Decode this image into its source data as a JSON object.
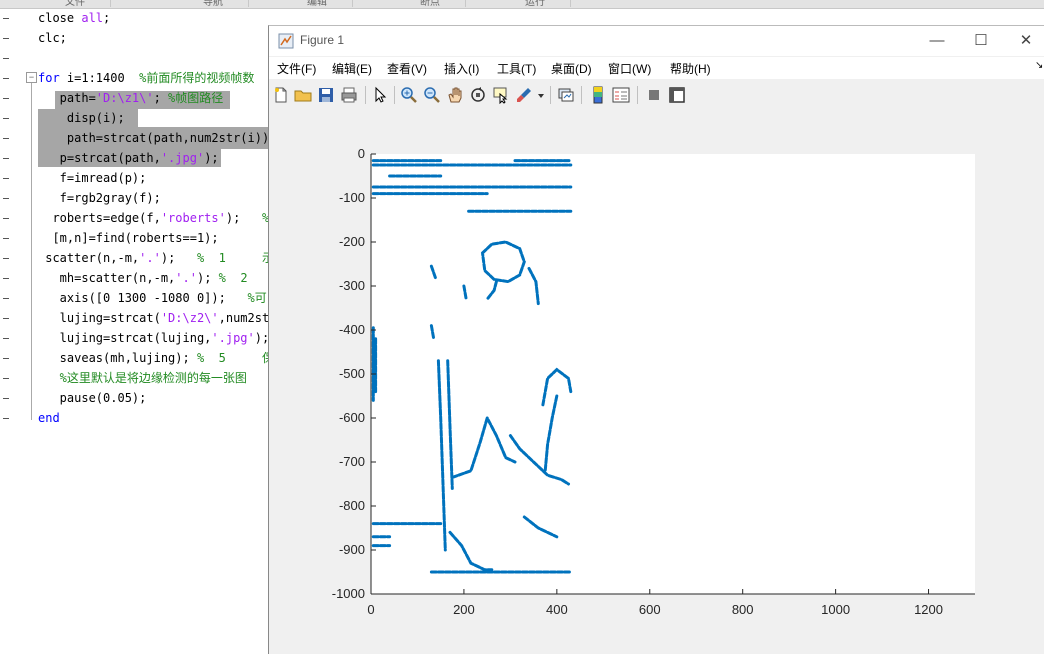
{
  "editor": {
    "top_tabs": [
      "文件",
      "导航",
      "编辑",
      "断点",
      "运行"
    ],
    "lines": [
      {
        "segments": [
          {
            "t": "close ",
            "c": "n"
          },
          {
            "t": "all",
            "c": "str"
          },
          {
            "t": ";",
            "c": "n"
          }
        ]
      },
      {
        "segments": [
          {
            "t": "clc;",
            "c": "n"
          }
        ]
      },
      {
        "segments": []
      },
      {
        "segments": [
          {
            "t": "for",
            "c": "kw"
          },
          {
            "t": " i=1:1400  ",
            "c": "n"
          },
          {
            "t": "%前面所得的视频帧数",
            "c": "com"
          }
        ]
      },
      {
        "segments": [
          {
            "t": "   path=",
            "c": "n"
          },
          {
            "t": "'D:\\z1\\'",
            "c": "str"
          },
          {
            "t": "; ",
            "c": "n"
          },
          {
            "t": "%帧图路径",
            "c": "com"
          }
        ]
      },
      {
        "segments": [
          {
            "t": "    disp(i);",
            "c": "n"
          }
        ]
      },
      {
        "segments": [
          {
            "t": "    path=strcat(path,num2str(i))",
            "c": "n"
          }
        ]
      },
      {
        "segments": [
          {
            "t": "   p=strcat(path,",
            "c": "n"
          },
          {
            "t": "'.jpg'",
            "c": "str"
          },
          {
            "t": ");",
            "c": "n"
          }
        ]
      },
      {
        "segments": [
          {
            "t": "   f=imread(p);",
            "c": "n"
          }
        ]
      },
      {
        "segments": [
          {
            "t": "   f=rgb2gray(f);",
            "c": "n"
          }
        ]
      },
      {
        "segments": [
          {
            "t": "  roberts=edge(f,",
            "c": "n"
          },
          {
            "t": "'roberts'",
            "c": "str"
          },
          {
            "t": ");   ",
            "c": "n"
          },
          {
            "t": "%",
            "c": "com"
          }
        ]
      },
      {
        "segments": [
          {
            "t": "  [m,n]=find(roberts==1);",
            "c": "n"
          }
        ]
      },
      {
        "segments": [
          {
            "t": " scatter(n,-m,",
            "c": "n"
          },
          {
            "t": "'.'",
            "c": "str"
          },
          {
            "t": ");   ",
            "c": "n"
          },
          {
            "t": "%  1     示",
            "c": "com"
          }
        ]
      },
      {
        "segments": [
          {
            "t": "   mh=scatter(n,-m,",
            "c": "n"
          },
          {
            "t": "'.'",
            "c": "str"
          },
          {
            "t": "); ",
            "c": "n"
          },
          {
            "t": "%  2",
            "c": "com"
          }
        ]
      },
      {
        "segments": [
          {
            "t": "   axis([0 1300 -1080 0]);   ",
            "c": "n"
          },
          {
            "t": "%可",
            "c": "com"
          }
        ]
      },
      {
        "segments": [
          {
            "t": "   lujing=strcat(",
            "c": "n"
          },
          {
            "t": "'D:\\z2\\'",
            "c": "str"
          },
          {
            "t": ",num2st",
            "c": "n"
          }
        ]
      },
      {
        "segments": [
          {
            "t": "   lujing=strcat(lujing,",
            "c": "n"
          },
          {
            "t": "'.jpg'",
            "c": "str"
          },
          {
            "t": ");",
            "c": "n"
          }
        ]
      },
      {
        "segments": [
          {
            "t": "   saveas(mh,lujing); ",
            "c": "n"
          },
          {
            "t": "%  5     保",
            "c": "com"
          }
        ]
      },
      {
        "segments": [
          {
            "t": "   %这里默认是将边缘检测的每一张图",
            "c": "com"
          }
        ]
      },
      {
        "segments": [
          {
            "t": "   pause(0.05);",
            "c": "n"
          }
        ]
      },
      {
        "segments": [
          {
            "t": "end",
            "c": "kw"
          }
        ]
      }
    ]
  },
  "figure": {
    "title": "Figure 1",
    "window_buttons": {
      "minimize": "—",
      "maximize": "☐",
      "close": "✕"
    },
    "menus": [
      "文件(F)",
      "编辑(E)",
      "查看(V)",
      "插入(I)",
      "工具(T)",
      "桌面(D)",
      "窗口(W)",
      "帮助(H)"
    ],
    "toolbar_icons": [
      "new-figure-icon",
      "open-file-icon",
      "save-icon",
      "print-icon",
      "select-arrow-icon",
      "zoom-in-icon",
      "zoom-out-icon",
      "pan-hand-icon",
      "rotate-3d-icon",
      "data-cursor-icon",
      "brush-icon",
      "brush-dropdown-icon",
      "link-plot-icon",
      "colorbar-icon",
      "legend-icon",
      "hide-plot-tools-icon",
      "show-plot-tools-icon"
    ],
    "menu_overflow": "↘"
  },
  "chart_data": {
    "type": "scatter",
    "title": "",
    "xlabel": "",
    "ylabel": "",
    "xlim": [
      0,
      1300
    ],
    "ylim": [
      -1000,
      0
    ],
    "xticks": [
      0,
      200,
      400,
      600,
      800,
      1000,
      1200
    ],
    "yticks": [
      0,
      -100,
      -200,
      -300,
      -400,
      -500,
      -600,
      -700,
      -800,
      -900,
      -1000
    ],
    "grid": false,
    "marker_color": "#0072bd",
    "series": [
      {
        "name": "",
        "strokes": [
          [
            [
              5,
              -15
            ],
            [
              150,
              -15
            ]
          ],
          [
            [
              310,
              -15
            ],
            [
              430,
              -15
            ]
          ],
          [
            [
              5,
              -25
            ],
            [
              430,
              -25
            ]
          ],
          [
            [
              40,
              -50
            ],
            [
              150,
              -50
            ]
          ],
          [
            [
              5,
              -75
            ],
            [
              430,
              -75
            ]
          ],
          [
            [
              5,
              -90
            ],
            [
              250,
              -90
            ]
          ],
          [
            [
              210,
              -130
            ],
            [
              430,
              -130
            ]
          ],
          [
            [
              240,
              -225
            ],
            [
              260,
              -205
            ],
            [
              290,
              -200
            ],
            [
              320,
              -215
            ],
            [
              330,
              -245
            ],
            [
              320,
              -275
            ],
            [
              295,
              -290
            ],
            [
              265,
              -285
            ],
            [
              245,
              -265
            ],
            [
              240,
              -225
            ]
          ],
          [
            [
              270,
              -290
            ],
            [
              265,
              -310
            ],
            [
              250,
              -330
            ]
          ],
          [
            [
              145,
              -470
            ],
            [
              150,
              -600
            ],
            [
              155,
              -750
            ],
            [
              160,
              -900
            ]
          ],
          [
            [
              165,
              -470
            ],
            [
              170,
              -620
            ],
            [
              175,
              -760
            ]
          ],
          [
            [
              175,
              -735
            ],
            [
              215,
              -720
            ],
            [
              235,
              -655
            ],
            [
              250,
              -600
            ],
            [
              270,
              -640
            ],
            [
              290,
              -690
            ],
            [
              310,
              -700
            ]
          ],
          [
            [
              300,
              -640
            ],
            [
              320,
              -670
            ],
            [
              350,
              -700
            ],
            [
              380,
              -730
            ],
            [
              410,
              -740
            ],
            [
              425,
              -750
            ]
          ],
          [
            [
              370,
              -570
            ],
            [
              380,
              -510
            ],
            [
              400,
              -490
            ],
            [
              425,
              -510
            ],
            [
              430,
              -540
            ]
          ],
          [
            [
              400,
              -550
            ],
            [
              390,
              -600
            ],
            [
              380,
              -660
            ],
            [
              375,
              -720
            ]
          ],
          [
            [
              170,
              -860
            ],
            [
              195,
              -890
            ],
            [
              215,
              -930
            ],
            [
              245,
              -945
            ],
            [
              260,
              -945
            ]
          ],
          [
            [
              5,
              -840
            ],
            [
              150,
              -840
            ]
          ],
          [
            [
              5,
              -870
            ],
            [
              40,
              -870
            ]
          ],
          [
            [
              5,
              -890
            ],
            [
              40,
              -890
            ]
          ],
          [
            [
              130,
              -950
            ],
            [
              430,
              -950
            ]
          ],
          [
            [
              5,
              -395
            ],
            [
              5,
              -560
            ]
          ],
          [
            [
              10,
              -420
            ],
            [
              10,
              -540
            ]
          ],
          [
            [
              130,
              -255
            ],
            [
              140,
              -285
            ]
          ],
          [
            [
              130,
              -390
            ],
            [
              135,
              -420
            ]
          ],
          [
            [
              200,
              -300
            ],
            [
              205,
              -330
            ]
          ],
          [
            [
              340,
              -260
            ],
            [
              355,
              -290
            ],
            [
              360,
              -340
            ]
          ],
          [
            [
              330,
              -825
            ],
            [
              360,
              -850
            ],
            [
              400,
              -870
            ]
          ]
        ]
      }
    ]
  }
}
